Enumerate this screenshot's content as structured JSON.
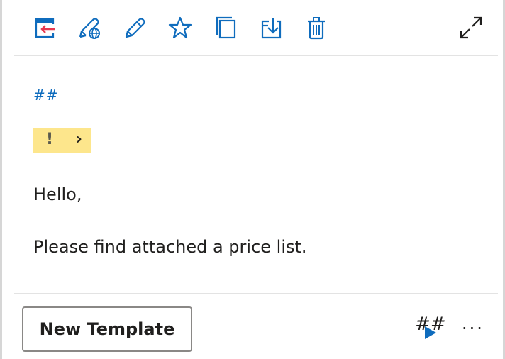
{
  "toolbar": {
    "icons": [
      {
        "name": "move-out-icon",
        "label": "Move out"
      },
      {
        "name": "edit-globe-icon",
        "label": "Edit shared"
      },
      {
        "name": "edit-icon",
        "label": "Edit"
      },
      {
        "name": "star-icon",
        "label": "Favorite"
      },
      {
        "name": "copy-icon",
        "label": "Copy"
      },
      {
        "name": "insert-icon",
        "label": "Insert"
      },
      {
        "name": "delete-icon",
        "label": "Delete"
      }
    ],
    "expand_icon": "expand-icon"
  },
  "content": {
    "hash_link": "##",
    "badge": {
      "exclaim": "!",
      "chevron": "›"
    },
    "lines": [
      "Hello,",
      "Please find attached a price list."
    ]
  },
  "footer": {
    "new_template_label": "New Template",
    "hash_play_label": "##",
    "more_label": "···"
  },
  "colors": {
    "accent": "#0f6cbd",
    "arrow_red": "#e8384f",
    "badge_bg": "#fde68c",
    "divider": "#e3e3e3",
    "text": "#201f1e"
  }
}
